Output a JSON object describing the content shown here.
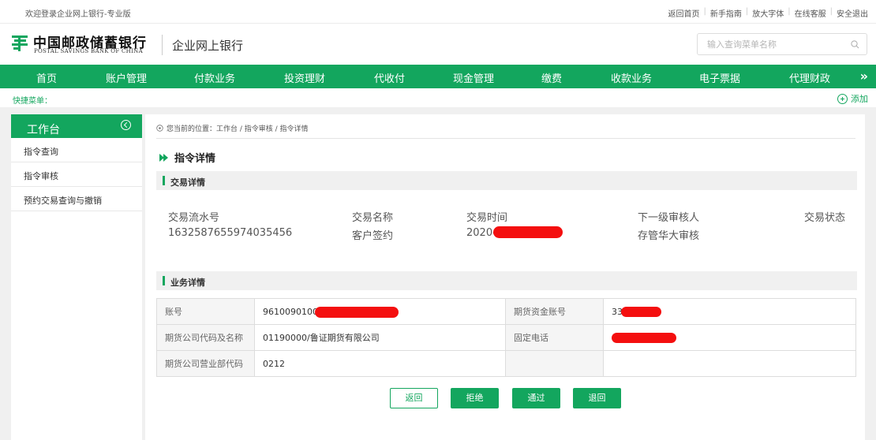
{
  "topbar": {
    "welcome": "欢迎登录企业网上银行-专业版",
    "links": [
      "返回首页",
      "新手指南",
      "放大字体",
      "在线客服",
      "安全退出"
    ]
  },
  "header": {
    "logo_cn": "中国邮政储蓄银行",
    "logo_en": "POSTAL SAVINGS BANK OF CHINA",
    "subtitle": "企业网上银行",
    "search_placeholder": "输入查询菜单名称"
  },
  "nav": {
    "items": [
      "首页",
      "账户管理",
      "付款业务",
      "投资理财",
      "代收付",
      "现金管理",
      "缴费",
      "收款业务",
      "电子票据",
      "代理财政"
    ],
    "more": "»"
  },
  "quick": {
    "label": "快捷菜单：",
    "add": "添加"
  },
  "sidebar": {
    "title": "工作台",
    "items": [
      "指令查询",
      "指令审核",
      "预约交易查询与撤销"
    ]
  },
  "breadcrumb": "您当前的位置：工作台 / 指令审核 / 指令详情",
  "page_title": "指令详情",
  "transaction": {
    "section_title": "交易详情",
    "labels": [
      "交易流水号",
      "交易名称",
      "交易时间",
      "下一级审核人",
      "交易状态"
    ],
    "values": [
      "1632587655974035456",
      "客户签约",
      "2020-",
      "存管华大审核",
      ""
    ]
  },
  "business": {
    "section_title": "业务详情",
    "rows": [
      {
        "k1": "账号",
        "v1": "96100901000",
        "k2": "期货资金账号",
        "v2": "33"
      },
      {
        "k1": "期货公司代码及名称",
        "v1": "01190000/鲁证期货有限公司",
        "k2": "固定电话",
        "v2": ""
      },
      {
        "k1": "期货公司营业部代码",
        "v1": "0212",
        "k2": "",
        "v2": ""
      }
    ]
  },
  "buttons": {
    "back": "返回",
    "reject": "拒绝",
    "pass": "通过",
    "return": "退回"
  },
  "colors": {
    "brand_green": "#13a65e",
    "redaction": "#f40f0f"
  }
}
